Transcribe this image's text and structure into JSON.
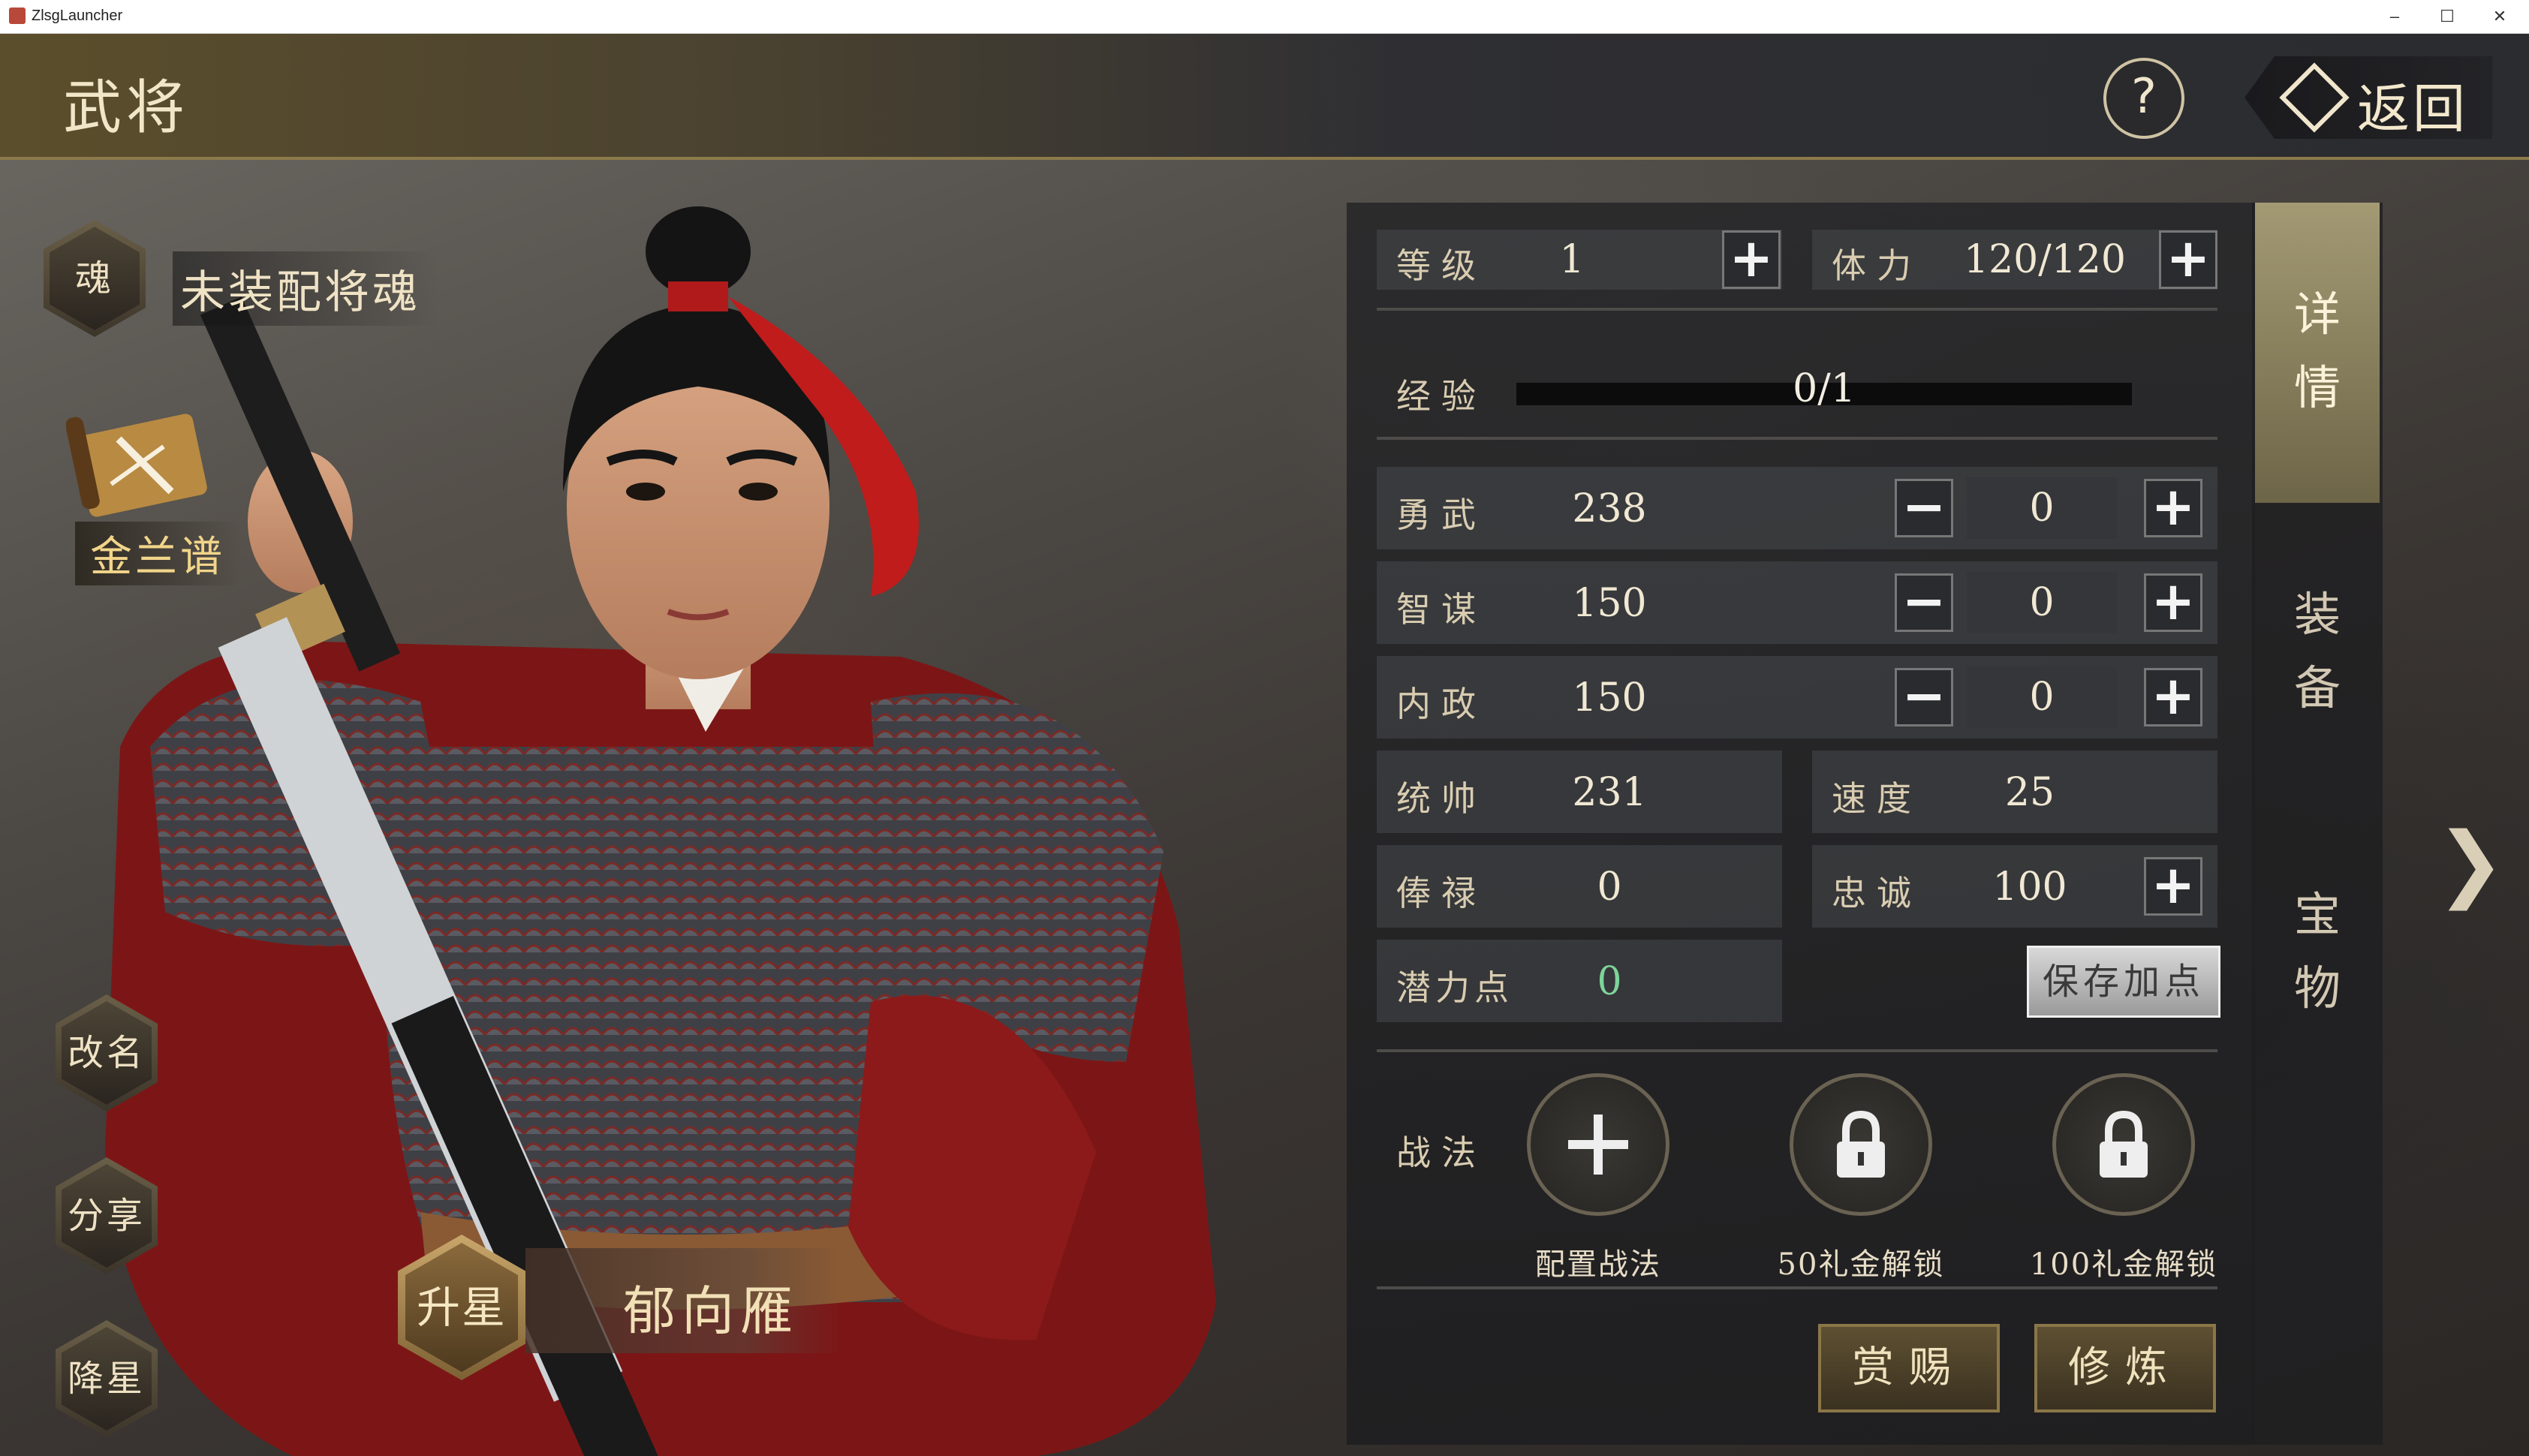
{
  "window": {
    "title": "ZlsgLauncher",
    "controls": {
      "minimize": "–",
      "maximize": "☐",
      "close": "✕"
    }
  },
  "header": {
    "title": "武将",
    "help_label": "?",
    "back_label": "返回"
  },
  "left": {
    "soul_icon_label": "魂",
    "soul_status": "未装配将魂",
    "bond_label": "金兰谱",
    "rename_label": "改名",
    "share_label": "分享",
    "downstar_label": "降星"
  },
  "hero": {
    "name": "郁向雁",
    "upstar_label": "升星"
  },
  "stats": {
    "level": {
      "label": "等级",
      "value": "1"
    },
    "stamina": {
      "label": "体力",
      "value": "120/120"
    },
    "exp": {
      "label": "经验",
      "value": "0/1",
      "progress": 0
    },
    "valor": {
      "label": "勇武",
      "value": "238",
      "alloc": "0"
    },
    "wisdom": {
      "label": "智谋",
      "value": "150",
      "alloc": "0"
    },
    "politics": {
      "label": "内政",
      "value": "150",
      "alloc": "0"
    },
    "command": {
      "label": "统帅",
      "value": "231"
    },
    "speed": {
      "label": "速度",
      "value": "25"
    },
    "salary": {
      "label": "俸禄",
      "value": "0"
    },
    "loyalty": {
      "label": "忠诚",
      "value": "100"
    },
    "potential": {
      "label": "潜力点",
      "value": "0"
    },
    "save_label": "保存加点"
  },
  "tactics": {
    "label": "战法",
    "slots": [
      {
        "caption": "配置战法",
        "icon": "plus-icon"
      },
      {
        "caption": "50礼金解锁",
        "icon": "lock-icon"
      },
      {
        "caption": "100礼金解锁",
        "icon": "lock-icon"
      }
    ]
  },
  "actions": {
    "reward_label": "赏赐",
    "train_label": "修炼"
  },
  "tabs": [
    {
      "label": "详情",
      "active": true
    },
    {
      "label": "装备",
      "active": false
    },
    {
      "label": "宝物",
      "active": false
    }
  ],
  "next_arrow": "❯",
  "colors": {
    "potential_value": "#7fd39a",
    "gold_text": "#f2d58a",
    "active_tab": "#a39a74"
  }
}
